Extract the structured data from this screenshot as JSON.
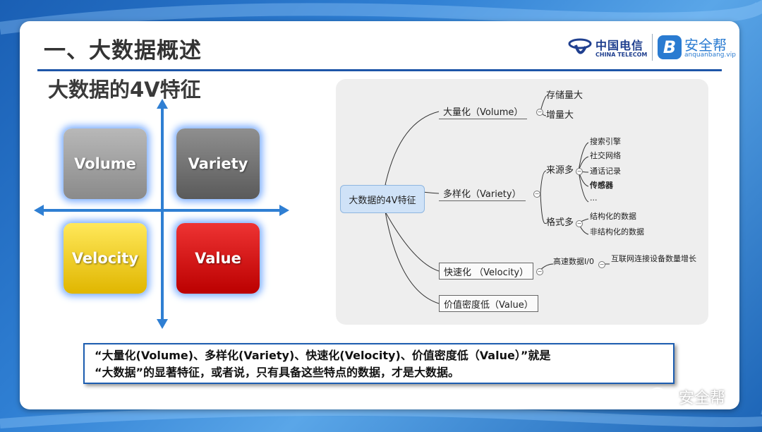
{
  "slide": {
    "title": "一、大数据概述",
    "subtitle": "大数据的4V特征"
  },
  "logos": {
    "telecom_cn": "中国电信",
    "telecom_en": "CHINA TELECOM",
    "anquanbang_badge": "B",
    "anquanbang_cn": "安全帮",
    "anquanbang_en": "anquanbang.vip"
  },
  "quadrants": {
    "volume": "Volume",
    "variety": "Variety",
    "velocity": "Velocity",
    "value": "Value"
  },
  "mindmap": {
    "root": "大数据的4V特征",
    "volume": {
      "label": "大量化（Volume）",
      "children": [
        "存储量大",
        "增量大"
      ]
    },
    "variety": {
      "label": "多样化（Variety）",
      "source": {
        "label": "来源多",
        "children": [
          "搜索引擎",
          "社交网络",
          "通话记录",
          "传感器",
          "..."
        ]
      },
      "format": {
        "label": "格式多",
        "children": [
          "结构化的数据",
          "非结构化的数据"
        ]
      }
    },
    "velocity": {
      "label": "快速化 （Velocity）",
      "child": "高速数据I/0",
      "grandchild": "互联网连接设备数量增长"
    },
    "value": {
      "label": "价值密度低（Value）"
    }
  },
  "quote": {
    "line1": "“大量化(Volume)、多样化(Variety)、快速化(Velocity)、价值密度低（Value）”就是",
    "line2": "“大数据”的显著特征，或者说，只有具备这些特点的数据，才是大数据。"
  },
  "watermark": "安全帮",
  "colors": {
    "accent": "#1e56a8",
    "volume": "#a0a0a0",
    "variety": "#707070",
    "velocity": "#f2d21a",
    "value": "#cc1111"
  }
}
